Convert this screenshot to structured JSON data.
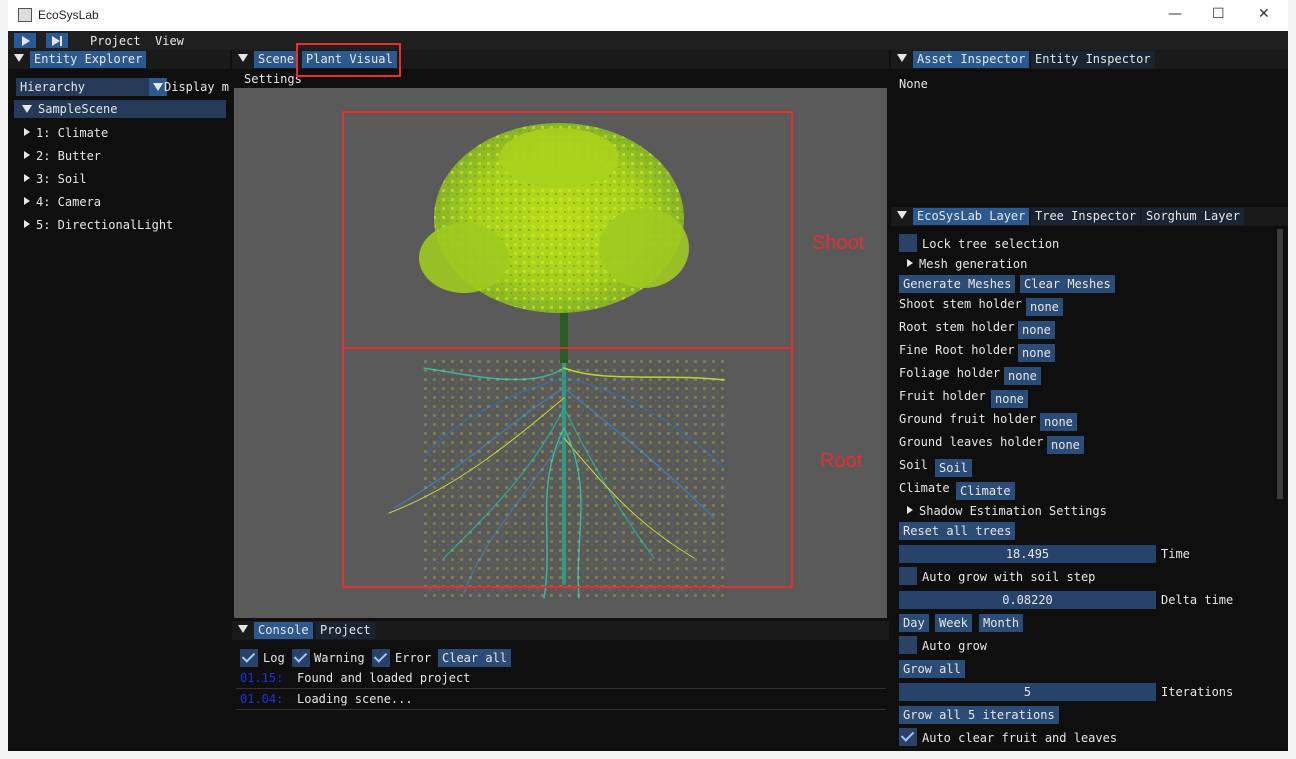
{
  "window": {
    "title": "EcoSysLab",
    "minimize": "—",
    "maximize": "☐",
    "close": "✕"
  },
  "menu": {
    "items": [
      "Project",
      "View"
    ]
  },
  "entity_explorer": {
    "tab": "Entity Explorer",
    "dropdown": "Hierarchy",
    "display_label": "Display m",
    "scene": "SampleScene",
    "entities": [
      "1: Climate",
      "2: Butter",
      "3: Soil",
      "4: Camera",
      "5: DirectionalLight"
    ]
  },
  "viewport": {
    "tabs": [
      "Scene",
      "Plant Visual"
    ],
    "settings": "Settings",
    "annotations": {
      "shoot": "Shoot",
      "root": "Root"
    }
  },
  "console": {
    "tabs": [
      "Console",
      "Project"
    ],
    "filters": {
      "log": "Log",
      "warning": "Warning",
      "error": "Error"
    },
    "clear_all": "Clear all",
    "entries": [
      {
        "time": "01.15:",
        "message": "Found and loaded project"
      },
      {
        "time": "01.04:",
        "message": "Loading scene..."
      }
    ]
  },
  "inspector": {
    "tabs": [
      "Asset Inspector",
      "Entity Inspector"
    ],
    "value": "None"
  },
  "layer": {
    "tabs": [
      "EcoSysLab Layer",
      "Tree Inspector",
      "Sorghum Layer"
    ],
    "lock_tree": "Lock tree selection",
    "mesh_generation": "Mesh generation",
    "generate_meshes": "Generate Meshes",
    "clear_meshes": "Clear Meshes",
    "holders": [
      {
        "label": "Shoot stem holder",
        "value": "none"
      },
      {
        "label": "Root stem holder",
        "value": "none"
      },
      {
        "label": "Fine Root holder",
        "value": "none"
      },
      {
        "label": "Foliage holder",
        "value": "none"
      },
      {
        "label": "Fruit holder",
        "value": "none"
      },
      {
        "label": "Ground fruit holder",
        "value": "none"
      },
      {
        "label": "Ground leaves holder",
        "value": "none"
      },
      {
        "label": "Soil",
        "value": "Soil"
      },
      {
        "label": "Climate",
        "value": "Climate"
      }
    ],
    "shadow_settings": "Shadow Estimation Settings",
    "reset_all": "Reset all trees",
    "time_value": "18.495",
    "time_label": "Time",
    "auto_grow_soil": "Auto grow with soil step",
    "delta_value": "0.08220",
    "delta_label": "Delta time",
    "periods": [
      "Day",
      "Week",
      "Month"
    ],
    "auto_grow": "Auto grow",
    "grow_all": "Grow all",
    "iterations_value": "5",
    "iterations_label": "Iterations",
    "grow_iterations": "Grow all 5 iterations",
    "auto_clear": "Auto clear fruit and leaves"
  },
  "colors": {
    "accent": "#2d5a8e",
    "annotation": "#e53030",
    "foliage": "#a8d61a",
    "roots": "#2aa8a0"
  }
}
